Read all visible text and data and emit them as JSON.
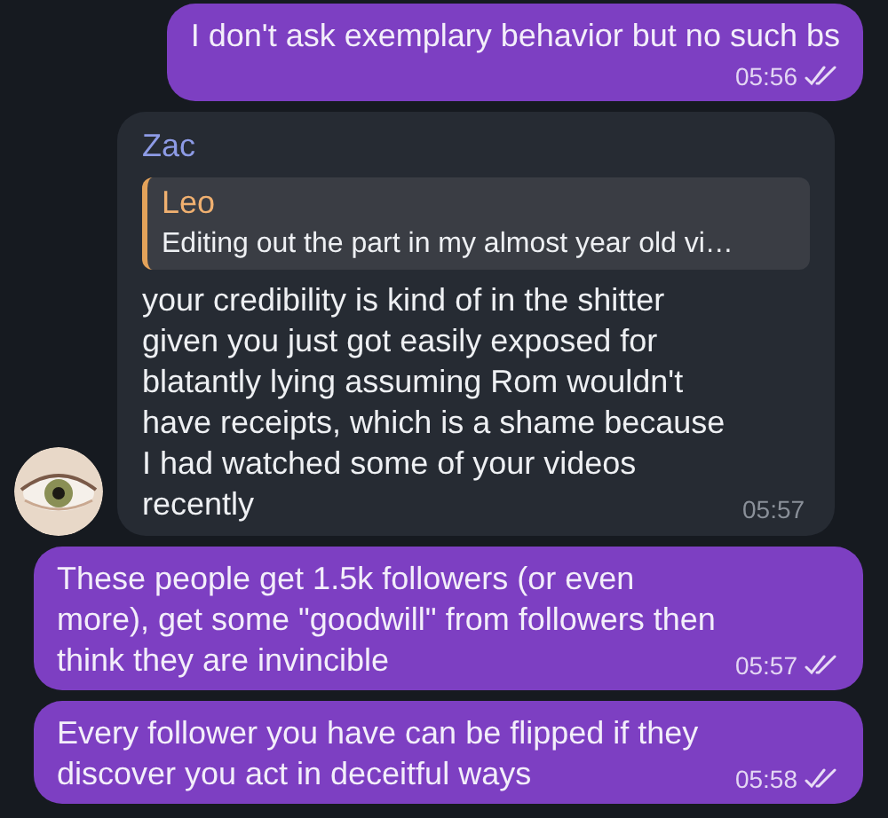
{
  "messages": [
    {
      "kind": "outgoing",
      "text": "I don't ask exemplary behavior but no such bs",
      "time": "05:56",
      "read": true,
      "time_below": true
    },
    {
      "kind": "incoming",
      "sender": "Zac",
      "reply": {
        "author": "Leo",
        "text": "Editing out the part in my almost year old vi…"
      },
      "text": "your credibility is kind of in the shitter given you just got easily exposed for blatantly lying assuming Rom wouldn't have receipts, which is a shame because I had watched some of your videos recently",
      "time": "05:57"
    },
    {
      "kind": "outgoing",
      "text": "These people get 1.5k followers (or even more), get some \"goodwill\" from followers then think they are invincible",
      "time": "05:57",
      "read": true,
      "time_below": false
    },
    {
      "kind": "outgoing",
      "text": "Every follower you have can be flipped if they discover you act in deceitful ways",
      "time": "05:58",
      "read": true,
      "time_below": false
    }
  ]
}
